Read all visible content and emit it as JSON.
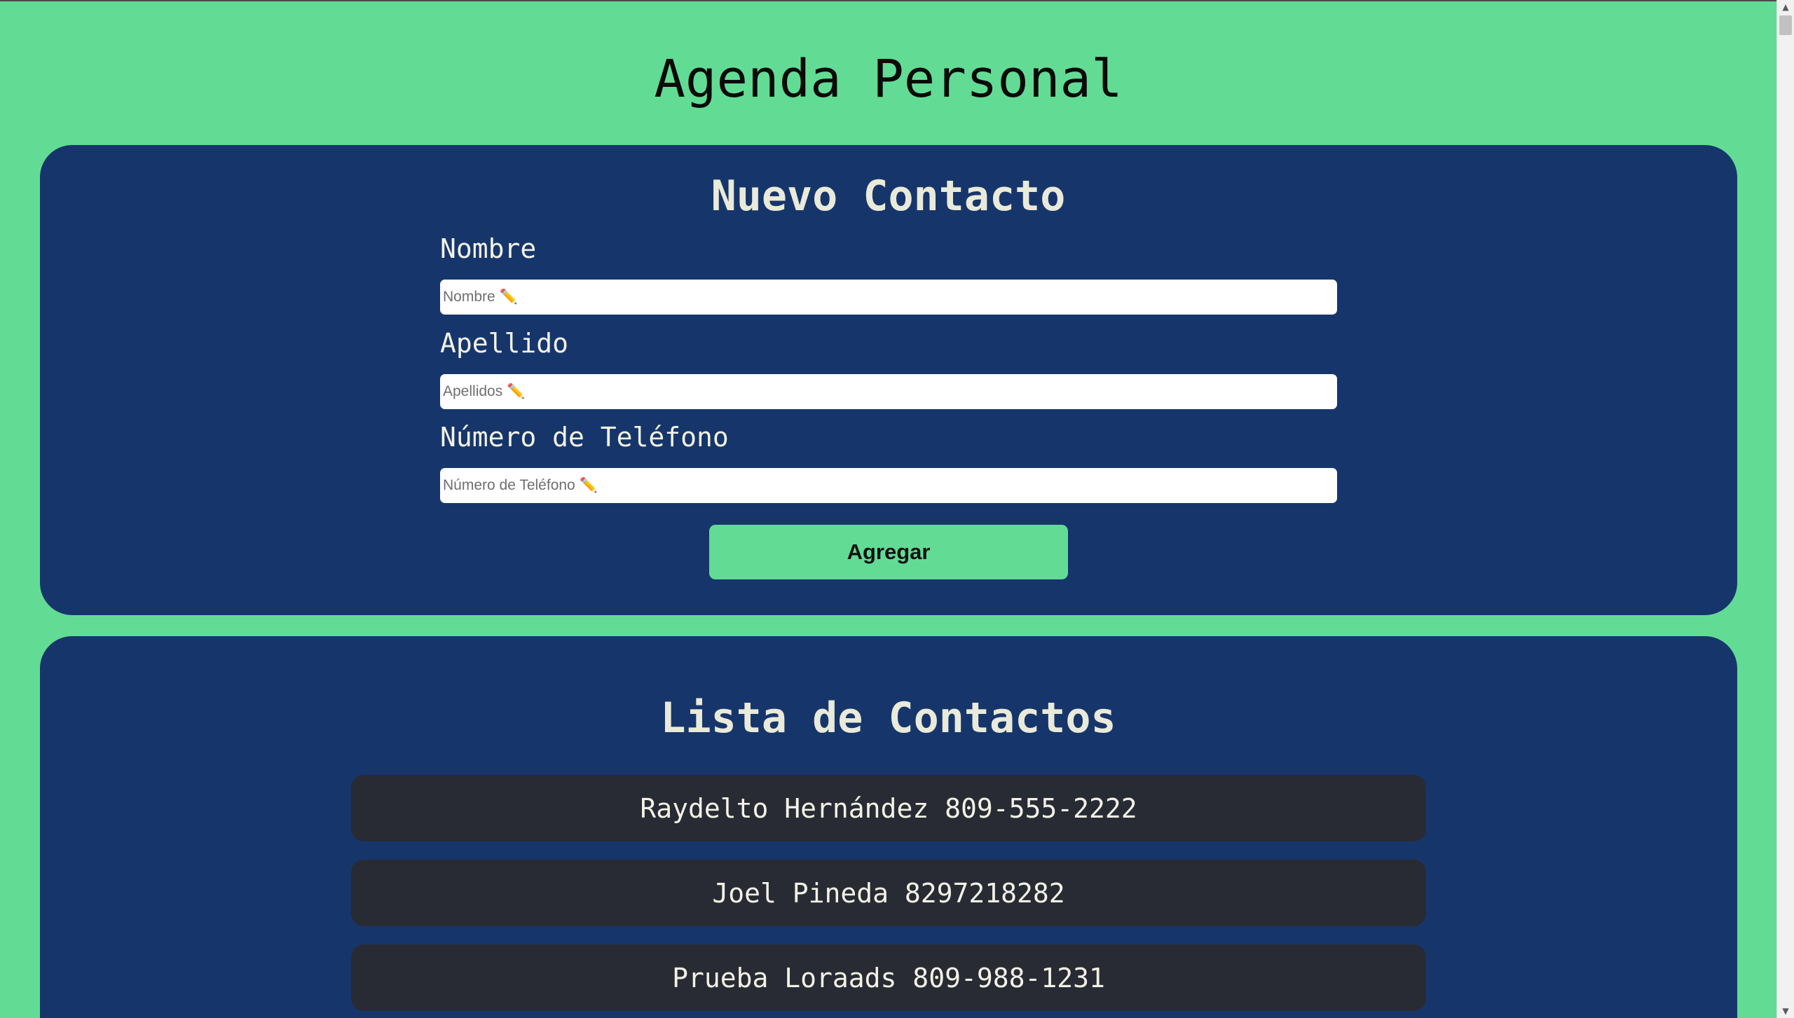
{
  "page": {
    "title": "Agenda Personal"
  },
  "form": {
    "heading": "Nuevo Contacto",
    "fields": [
      {
        "label": "Nombre",
        "placeholder": "Nombre ✏️",
        "value": ""
      },
      {
        "label": "Apellido",
        "placeholder": "Apellidos ✏️",
        "value": ""
      },
      {
        "label": "Número de Teléfono",
        "placeholder": "Número de Teléfono ✏️",
        "value": ""
      }
    ],
    "submit_label": "Agregar"
  },
  "contacts": {
    "heading": "Lista de Contactos",
    "items": [
      {
        "text": "Raydelto Hernández 809-555-2222"
      },
      {
        "text": "Joel Pineda 8297218282"
      },
      {
        "text": "Prueba Loraads 809-988-1231"
      }
    ]
  },
  "colors": {
    "background": "#62dc94",
    "card": "#16366b",
    "contact_item": "#282b33",
    "button": "#62dc94"
  }
}
